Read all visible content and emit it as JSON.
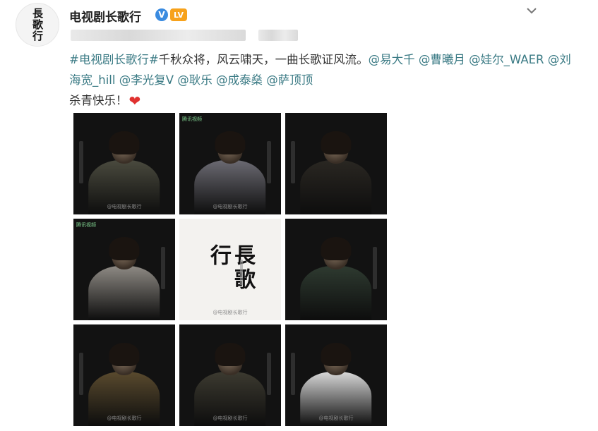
{
  "post": {
    "avatar_text": "長歌行",
    "username": "电视剧长歌行",
    "verified_badge": "V",
    "level_badge": "LV",
    "menu_icon": "chevron-down-icon",
    "text_segments": [
      {
        "t": "#电视剧长歌行#",
        "type": "hashtag"
      },
      {
        "t": "千秋众将，风云啸天，一曲长歌证风流。",
        "type": "text"
      },
      {
        "t": "@易大千",
        "type": "mention"
      },
      {
        "t": " ",
        "type": "text"
      },
      {
        "t": "@曹曦月",
        "type": "mention"
      },
      {
        "t": " ",
        "type": "text"
      },
      {
        "t": "@娃尔_WAER",
        "type": "mention"
      },
      {
        "t": " ",
        "type": "text"
      },
      {
        "t": "@刘海宽_hill",
        "type": "mention"
      },
      {
        "t": " ",
        "type": "text"
      },
      {
        "t": "@李光复V",
        "type": "mention"
      },
      {
        "t": " ",
        "type": "text"
      },
      {
        "t": "@耿乐",
        "type": "mention"
      },
      {
        "t": " ",
        "type": "text"
      },
      {
        "t": "@成泰燊",
        "type": "mention"
      },
      {
        "t": " ",
        "type": "text"
      },
      {
        "t": "@萨顶顶",
        "type": "mention"
      }
    ],
    "last_line": "杀青快乐！",
    "heart": "❤",
    "colors": {
      "link": "#3a7a84",
      "heart": "#e0312f",
      "badge_blue": "#3a8be0",
      "badge_orange": "#f7a21b"
    }
  },
  "images": [
    {
      "name": "poster-1",
      "theme": "dark",
      "body_color": "#4a4a3e",
      "has_logo": false,
      "watermark": "@电视剧长歌行"
    },
    {
      "name": "poster-2",
      "theme": "dark",
      "body_color": "#6b6a72",
      "has_logo": true,
      "logo": "腾讯视频",
      "watermark": "@电视剧长歌行"
    },
    {
      "name": "poster-3",
      "theme": "dark",
      "body_color": "#2a2722",
      "has_logo": false,
      "watermark": ""
    },
    {
      "name": "poster-4",
      "theme": "dark",
      "body_color": "#8e8a84",
      "has_logo": true,
      "logo": "腾讯视频",
      "watermark": ""
    },
    {
      "name": "poster-title",
      "theme": "light",
      "title": "長歌行",
      "watermark": "@电视剧长歌行"
    },
    {
      "name": "poster-6",
      "theme": "dark",
      "body_color": "#2e3a30",
      "has_logo": false,
      "watermark": ""
    },
    {
      "name": "poster-7",
      "theme": "dark",
      "body_color": "#5a4a2e",
      "has_logo": false,
      "watermark": "@电视剧长歌行"
    },
    {
      "name": "poster-8",
      "theme": "dark",
      "body_color": "#3c3a30",
      "has_logo": false,
      "watermark": "@电视剧长歌行"
    },
    {
      "name": "poster-9",
      "theme": "dark",
      "body_color": "#d8d8d8",
      "has_logo": false,
      "watermark": "@电视剧长歌行"
    }
  ]
}
